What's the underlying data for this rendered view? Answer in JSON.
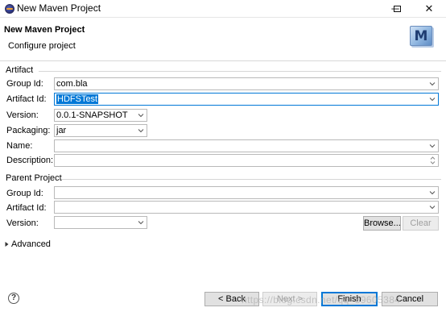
{
  "window": {
    "title": "New Maven Project",
    "minimize_glyph": "─",
    "maximize_glyph": "☐",
    "close_glyph": "✕"
  },
  "header": {
    "title": "New Maven Project",
    "subtitle": "Configure project",
    "logo_letter": "M"
  },
  "artifact": {
    "group_label": "Artifact",
    "group_id": {
      "label": "Group Id:",
      "value": "com.bla"
    },
    "artifact_id": {
      "label": "Artifact Id:",
      "value": "HDFSTest"
    },
    "version": {
      "label": "Version:",
      "value": "0.0.1-SNAPSHOT"
    },
    "packaging": {
      "label": "Packaging:",
      "value": "jar"
    },
    "name": {
      "label": "Name:",
      "value": ""
    },
    "description": {
      "label": "Description:",
      "value": ""
    }
  },
  "parent": {
    "group_label": "Parent Project",
    "group_id": {
      "label": "Group Id:",
      "value": ""
    },
    "artifact_id": {
      "label": "Artifact Id:",
      "value": ""
    },
    "version": {
      "label": "Version:",
      "value": ""
    },
    "browse_label": "Browse...",
    "clear_label": "Clear"
  },
  "advanced": {
    "label": "Advanced",
    "expander_glyph": "›"
  },
  "footer": {
    "help_glyph": "?",
    "back_label": "< Back",
    "next_label": "Next >",
    "finish_label": "Finish",
    "cancel_label": "Cancel"
  },
  "watermark": "https://blog.csdn.net/qq_39605384",
  "colors": {
    "focus": "#0078d7",
    "selection": "#0078d7",
    "button_bg": "#e1e1e1"
  }
}
